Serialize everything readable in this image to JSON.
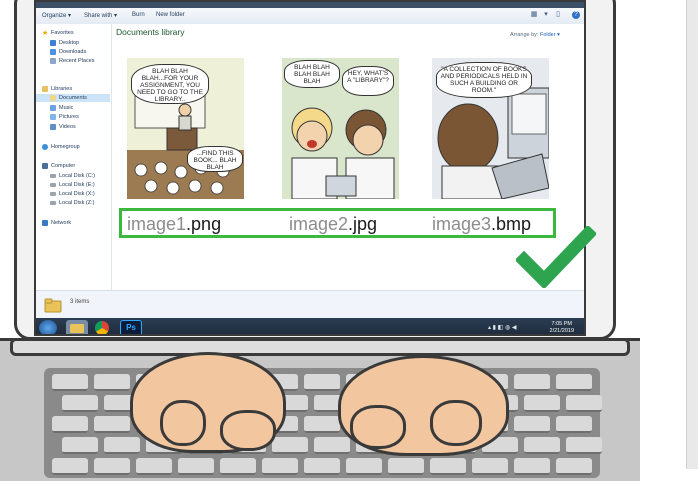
{
  "toolbar": {
    "organize": "Organize",
    "share_with": "Share with",
    "burn": "Burn",
    "new_folder": "New folder"
  },
  "nav": {
    "favorites": "Favorites",
    "desktop": "Desktop",
    "downloads": "Downloads",
    "recent_places": "Recent Places",
    "libraries": "Libraries",
    "documents": "Documents",
    "music": "Music",
    "pictures": "Pictures",
    "videos": "Videos",
    "homegroup": "Homegroup",
    "computer": "Computer",
    "local_c": "Local Disk (C:)",
    "local_e": "Local Disk (E:)",
    "local_x": "Local Disk (X:)",
    "local_z": "Local Disk (Z:)",
    "network": "Network"
  },
  "content": {
    "library_title": "Documents library",
    "arrange_label": "Arrange by:",
    "arrange_value": "Folder"
  },
  "comics": [
    {
      "bubble_top": "BLAH BLAH BLAH...FOR YOUR ASSIGNMENT, YOU NEED TO GO TO THE LIBRARY..",
      "bubble_bottom": "...FIND THIS BOOK... BLAH BLAH"
    },
    {
      "bubble_left": "BLAH BLAH BLAH BLAH BLAH",
      "bubble_right": "HEY, WHAT'S A \"LIBRARY\"?"
    },
    {
      "bubble_top": "\"A COLLECTION OF BOOKS AND PERIODICALS HELD IN SUCH A BUILDING OR ROOM.\""
    }
  ],
  "files": [
    {
      "base": "image1",
      "ext": ".png"
    },
    {
      "base": "image2",
      "ext": ".jpg"
    },
    {
      "base": "image3",
      "ext": ".bmp"
    }
  ],
  "status": {
    "items": "3 items"
  },
  "clock": {
    "time": "7:05 PM",
    "date": "2/21/2019"
  },
  "taskbar": {
    "ps_label": "Ps"
  },
  "colors": {
    "highlight_green": "#3cb83f",
    "checkmark_green": "#2ea44f",
    "library_title": "#1e5a2e"
  }
}
